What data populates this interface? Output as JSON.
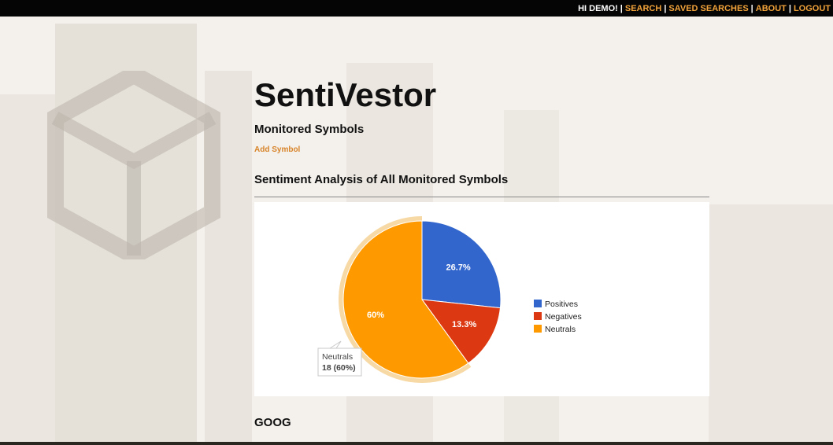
{
  "topbar": {
    "greeting": "HI DEMO!",
    "links": [
      "SEARCH",
      "SAVED SEARCHES",
      "ABOUT",
      "LOGOUT"
    ]
  },
  "page": {
    "title": "SentiVestor",
    "monitored_heading": "Monitored Symbols",
    "add_symbol": "Add Symbol",
    "section_heading": "Sentiment Analysis of All Monitored Symbols",
    "next_symbol": "GOOG"
  },
  "chart_data": {
    "type": "pie",
    "slices": [
      {
        "label": "Positives",
        "percent": 26.7,
        "percent_label": "26.7%",
        "color": "#3366cc"
      },
      {
        "label": "Negatives",
        "percent": 13.3,
        "percent_label": "13.3%",
        "color": "#dc3912"
      },
      {
        "label": "Neutrals",
        "percent": 60,
        "percent_label": "60%",
        "color": "#ff9900",
        "highlighted": true
      }
    ],
    "legend_position": "right",
    "tooltip": {
      "title": "Neutrals",
      "detail": "18 (60%)"
    }
  }
}
